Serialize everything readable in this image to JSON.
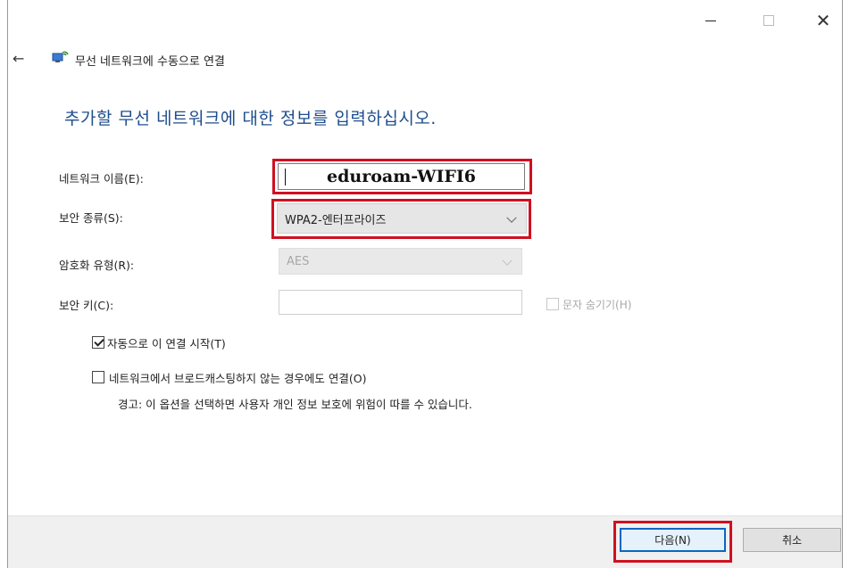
{
  "titlebar": {
    "minimize": "—",
    "maximize": "□",
    "close": "✕"
  },
  "header": {
    "back_icon": "back-arrow-icon",
    "title": "무선 네트워크에 수동으로 연결"
  },
  "main": {
    "heading": "추가할 무선 네트워크에 대한 정보를 입력하십시오."
  },
  "form": {
    "network_name": {
      "label": "네트워크 이름(E):",
      "value": "eduroam-WIFI6"
    },
    "security_type": {
      "label": "보안 종류(S):",
      "value": "WPA2-엔터프라이즈"
    },
    "encryption_type": {
      "label": "암호화 유형(R):",
      "value": "AES"
    },
    "security_key": {
      "label": "보안 키(C):",
      "value": "",
      "hide_chars_label": "문자 숨기기(H)"
    }
  },
  "options": {
    "auto_connect": {
      "label": "자동으로 이 연결 시작(T)",
      "checked": true
    },
    "broadcast": {
      "label": "네트워크에서 브로드캐스팅하지 않는 경우에도 연결(O)",
      "checked": false
    },
    "warning": "경고: 이 옵션을 선택하면 사용자 개인 정보 보호에 위험이 따를 수 있습니다."
  },
  "buttons": {
    "next": "다음(N)",
    "cancel": "취소"
  },
  "colors": {
    "heading": "#1f4e8c",
    "highlight": "#d01020",
    "focus": "#0a66c2"
  }
}
